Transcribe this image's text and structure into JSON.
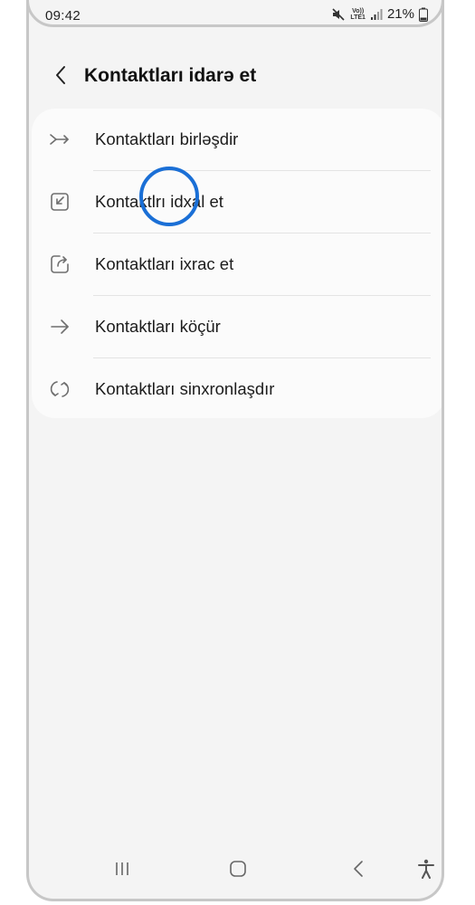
{
  "status_bar": {
    "time": "09:42",
    "volte_top": "Vo))",
    "volte_bottom": "LTE1",
    "battery_percent": "21%",
    "icons": [
      "mute-icon",
      "volte-icon",
      "signal-icon",
      "battery-icon"
    ]
  },
  "header": {
    "title": "Kontaktları idarə et",
    "back_icon": "chevron-left-icon"
  },
  "menu": {
    "items": [
      {
        "label": "Kontaktları birləşdir",
        "icon": "merge-icon"
      },
      {
        "label": "Kontaktlrı idxal et",
        "icon": "import-icon"
      },
      {
        "label": "Kontaktları ixrac et",
        "icon": "export-icon"
      },
      {
        "label": "Kontaktları köçür",
        "icon": "arrow-right-icon"
      },
      {
        "label": "Kontaktları sinxronlaşdır",
        "icon": "sync-icon"
      }
    ]
  },
  "nav_bar": {
    "icons": [
      "recents-icon",
      "home-icon",
      "back-icon",
      "accessibility-icon"
    ]
  },
  "colors": {
    "background": "#f4f4f4",
    "card": "#fbfbfb",
    "tap_indicator": "#1a6fd6",
    "text": "#1c1c1c",
    "icon": "#6e6e6e"
  }
}
